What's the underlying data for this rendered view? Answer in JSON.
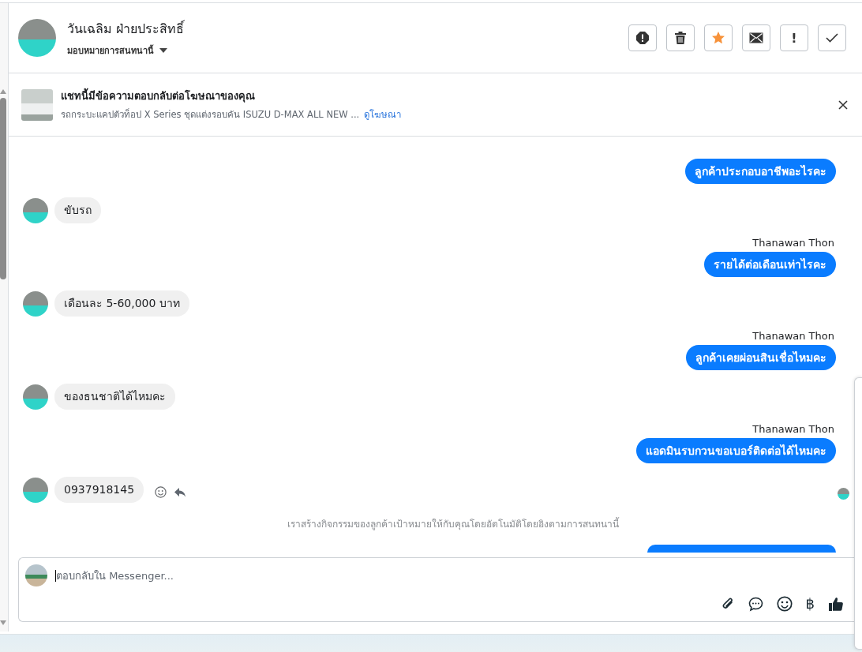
{
  "contact": {
    "name": "วันเฉลิม ฝ่ายประสิทธิ์",
    "assign_label": "มอบหมายการสนทนานี้"
  },
  "actions": [
    {
      "kind": "spam"
    },
    {
      "kind": "delete"
    },
    {
      "kind": "star",
      "on": true
    },
    {
      "kind": "unread"
    },
    {
      "kind": "follow-up",
      "label": "!"
    },
    {
      "kind": "done"
    }
  ],
  "ad": {
    "title": "แชทนี้มีข้อความตอบกลับต่อโฆษณาของคุณ",
    "description": "รถกระบะแคปตัวท็อป X Series ชุดแต่งรอบคัน ISUZU D-MAX ALL NEW ...",
    "link": "ดูโฆษณา"
  },
  "messages": [
    {
      "kind": "outgoing",
      "text": "ลูกค้าประกอบอาชีพอะไรคะ"
    },
    {
      "kind": "incoming",
      "text": "ขับรถ"
    },
    {
      "kind": "outgoing",
      "sender": "Thanawan Thon",
      "text": "รายได้ต่อเดือนเท่าไรคะ"
    },
    {
      "kind": "incoming",
      "text": "เดือนละ 5-60,000 บาท"
    },
    {
      "kind": "outgoing",
      "sender": "Thanawan Thon",
      "text": "ลูกค้าเคยผ่อนสินเชื่อไหมคะ"
    },
    {
      "kind": "incoming",
      "text": "ของธนชาติได้ไหมคะ"
    },
    {
      "kind": "outgoing",
      "sender": "Thanawan Thon",
      "text": "แอดมินรบกวนขอเบอร์ติดต่อได้ไหมคะ"
    },
    {
      "kind": "incoming",
      "text": "0937918145",
      "tools": [
        {
          "kind": "react"
        },
        {
          "kind": "reply"
        }
      ],
      "seen": true
    },
    {
      "kind": "note",
      "text": "เราสร้างกิจกรรมของลูกค้าเป้าหมายให้กับคุณโดยอัตโนมัติโดยอิงตามการสนทนานี้"
    },
    {
      "kind": "outgoing-partial"
    }
  ],
  "composer": {
    "placeholder": "ตอบกลับใน Messenger...",
    "tools": [
      {
        "kind": "attach"
      },
      {
        "kind": "saved-reply"
      },
      {
        "kind": "emoji"
      },
      {
        "kind": "payment",
        "label": "฿"
      },
      {
        "kind": "like"
      }
    ]
  }
}
